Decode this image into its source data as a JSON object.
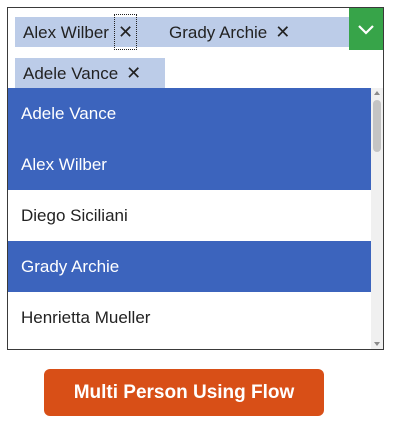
{
  "combobox": {
    "selected": [
      {
        "label": "Alex Wilber",
        "remove": "✕"
      },
      {
        "label": "Grady Archie",
        "remove": "✕"
      },
      {
        "label": "Adele Vance",
        "remove": "✕"
      }
    ],
    "accent_color": "#37a449"
  },
  "list": {
    "items": [
      {
        "label": "Adele Vance",
        "selected": true
      },
      {
        "label": "Alex Wilber",
        "selected": true
      },
      {
        "label": "Diego Siciliani",
        "selected": false
      },
      {
        "label": "Grady Archie",
        "selected": true
      },
      {
        "label": "Henrietta Mueller",
        "selected": false
      }
    ],
    "selected_color": "#3c64bd"
  },
  "button": {
    "label": "Multi Person Using Flow",
    "color": "#d84f17"
  }
}
